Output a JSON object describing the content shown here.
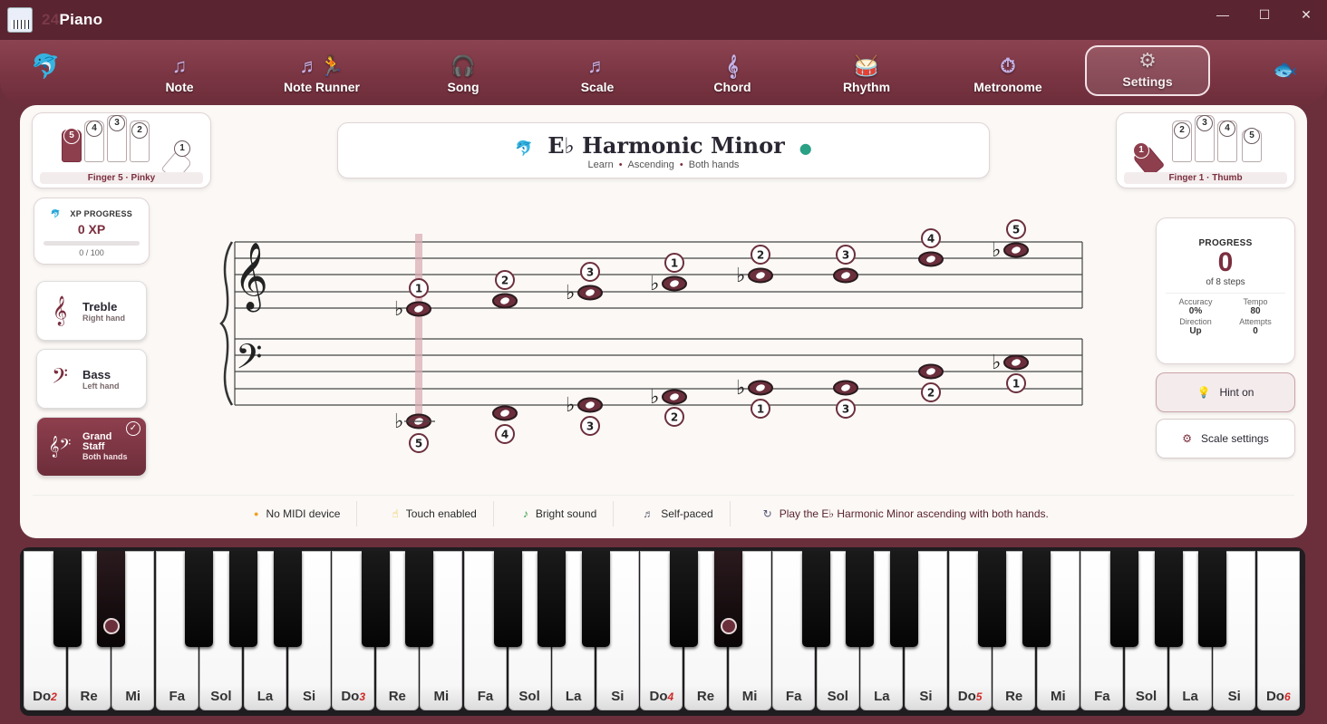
{
  "app": {
    "title_prefix": "24",
    "title": "Piano"
  },
  "window_controls": {
    "minimize": "—",
    "maximize": "☐",
    "close": "✕"
  },
  "nav": {
    "items": [
      {
        "label": "Note",
        "icon": "♫"
      },
      {
        "label": "Note Runner",
        "icon": "♬🏃"
      },
      {
        "label": "Song",
        "icon": "🎧"
      },
      {
        "label": "Scale",
        "icon": "♬"
      },
      {
        "label": "Chord",
        "icon": "𝄞"
      },
      {
        "label": "Rhythm",
        "icon": "🥁"
      },
      {
        "label": "Metronome",
        "icon": "⏱"
      },
      {
        "label": "Settings",
        "icon": "⚙"
      }
    ],
    "active": "Settings"
  },
  "left_finger": {
    "label": "Finger 5 · Pinky",
    "fingers": [
      "5",
      "4",
      "3",
      "2",
      "1"
    ]
  },
  "right_finger": {
    "label": "Finger 1 · Thumb",
    "fingers": [
      "1",
      "2",
      "3",
      "4",
      "5"
    ]
  },
  "scale": {
    "title": "E♭ Harmonic Minor",
    "mode": "Learn",
    "direction": "Ascending",
    "hands": "Both hands"
  },
  "xp": {
    "heading": "XP PROGRESS",
    "value": "0 XP",
    "range": "0 / 100",
    "fraction": 0
  },
  "clefs": [
    {
      "name": "Treble",
      "hand": "Right hand",
      "icon": "𝄞"
    },
    {
      "name": "Bass",
      "hand": "Left hand",
      "icon": "𝄢"
    },
    {
      "name": "Grand Staff",
      "hand": "Both hands",
      "icon": "𝄞𝄢",
      "selected": true
    }
  ],
  "progress": {
    "heading": "PROGRESS",
    "value": "0",
    "of": "of 8 steps",
    "accuracy_label": "Accuracy",
    "accuracy": "0%",
    "tempo_label": "Tempo",
    "tempo": "80",
    "direction_label": "Direction",
    "direction": "Up",
    "attempts_label": "Attempts",
    "attempts": "0"
  },
  "buttons": {
    "hint": "Hint on",
    "scale_settings": "Scale settings"
  },
  "status": {
    "midi": "No MIDI device",
    "touch": "Touch enabled",
    "sound": "Bright sound",
    "pace": "Self-paced",
    "instruction": "Play the E♭ Harmonic Minor ascending with both hands."
  },
  "staff": {
    "treble_fingers": [
      "1",
      "2",
      "3",
      "1",
      "2",
      "3",
      "4",
      "5"
    ],
    "bass_fingers": [
      "5",
      "4",
      "3",
      "2",
      "1",
      "3",
      "2",
      "1"
    ],
    "accidental": "♭"
  },
  "keyboard": {
    "white_keys": [
      "Do",
      "Re",
      "Mi",
      "Fa",
      "Sol",
      "La",
      "Si",
      "Do",
      "Re",
      "Mi",
      "Fa",
      "Sol",
      "La",
      "Si",
      "Do",
      "Re",
      "Mi",
      "Fa",
      "Sol",
      "La",
      "Si",
      "Do",
      "Re",
      "Mi",
      "Fa",
      "Sol",
      "La",
      "Si",
      "Do"
    ],
    "octaves": {
      "0": "2",
      "7": "3",
      "14": "4",
      "21": "5",
      "28": "6"
    },
    "highlighted_black_keys": [
      1,
      11
    ]
  }
}
